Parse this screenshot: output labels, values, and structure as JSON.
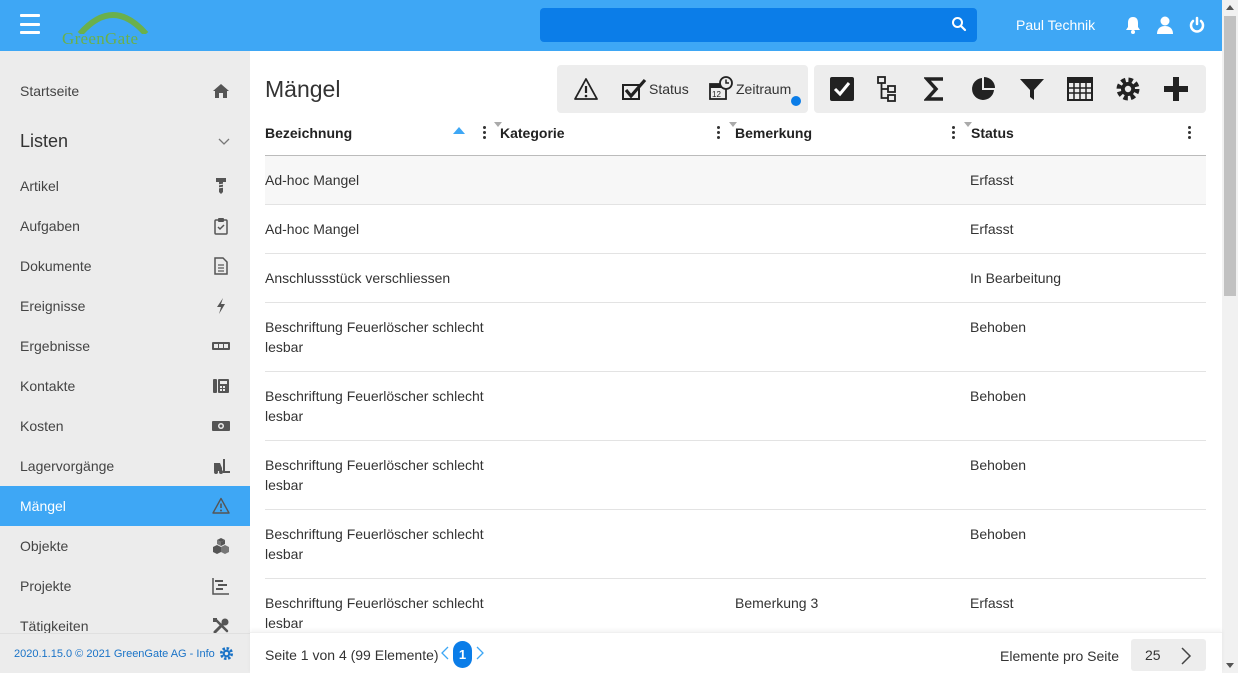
{
  "app": {
    "logo_text": "GreenGate",
    "user_name": "Paul Technik",
    "search": {
      "placeholder": "",
      "value": ""
    }
  },
  "sidebar": {
    "items_top": [
      {
        "label": "Startseite",
        "icon": "home-icon"
      }
    ],
    "section": {
      "label": "Listen",
      "icon": "chevron-down-icon"
    },
    "items": [
      {
        "label": "Artikel",
        "icon": "screw-icon"
      },
      {
        "label": "Aufgaben",
        "icon": "clipboard-check-icon"
      },
      {
        "label": "Dokumente",
        "icon": "document-icon"
      },
      {
        "label": "Ereignisse",
        "icon": "lightning-icon"
      },
      {
        "label": "Ergebnisse",
        "icon": "counter-icon"
      },
      {
        "label": "Kontakte",
        "icon": "phone-book-icon"
      },
      {
        "label": "Kosten",
        "icon": "money-icon"
      },
      {
        "label": "Lagervorgänge",
        "icon": "forklift-icon"
      },
      {
        "label": "Mängel",
        "icon": "warning-icon",
        "active": true
      },
      {
        "label": "Objekte",
        "icon": "cubes-icon"
      },
      {
        "label": "Projekte",
        "icon": "gantt-icon"
      },
      {
        "label": "Tätigkeiten",
        "icon": "tools-icon"
      }
    ],
    "footer_text": "2020.1.15.0 © 2021 GreenGate AG - Info"
  },
  "main": {
    "title": "Mängel",
    "toolbar": {
      "status_label": "Status",
      "zeitraum_label": "Zeitraum"
    },
    "columns": [
      "Bezeichnung",
      "Kategorie",
      "Bemerkung",
      "Status"
    ],
    "rows": [
      {
        "bezeichnung": "Ad-hoc Mangel",
        "kategorie": "",
        "bemerkung": "",
        "status": "Erfasst"
      },
      {
        "bezeichnung": "Ad-hoc Mangel",
        "kategorie": "",
        "bemerkung": "",
        "status": "Erfasst"
      },
      {
        "bezeichnung": "Anschlussstück verschliessen",
        "kategorie": "",
        "bemerkung": "",
        "status": "In Bearbeitung"
      },
      {
        "bezeichnung": "Beschriftung Feuerlöscher schlecht lesbar",
        "kategorie": "",
        "bemerkung": "",
        "status": "Behoben"
      },
      {
        "bezeichnung": "Beschriftung Feuerlöscher schlecht lesbar",
        "kategorie": "",
        "bemerkung": "",
        "status": "Behoben"
      },
      {
        "bezeichnung": "Beschriftung Feuerlöscher schlecht lesbar",
        "kategorie": "",
        "bemerkung": "",
        "status": "Behoben"
      },
      {
        "bezeichnung": "Beschriftung Feuerlöscher schlecht lesbar",
        "kategorie": "",
        "bemerkung": "",
        "status": "Behoben"
      },
      {
        "bezeichnung": "Beschriftung Feuerlöscher schlecht lesbar",
        "kategorie": "",
        "bemerkung": "Bemerkung 3",
        "status": "Erfasst"
      }
    ],
    "pagination": {
      "text": "Seite 1 von 4 (99 Elemente)",
      "current_page": "1",
      "per_page_label": "Elemente pro Seite",
      "per_page": "25"
    }
  },
  "colors": {
    "accent": "#3ea7f5",
    "search_bg": "#0b7de8",
    "sidebar_bg": "#ececec",
    "toolbar_bg": "#ededed"
  }
}
